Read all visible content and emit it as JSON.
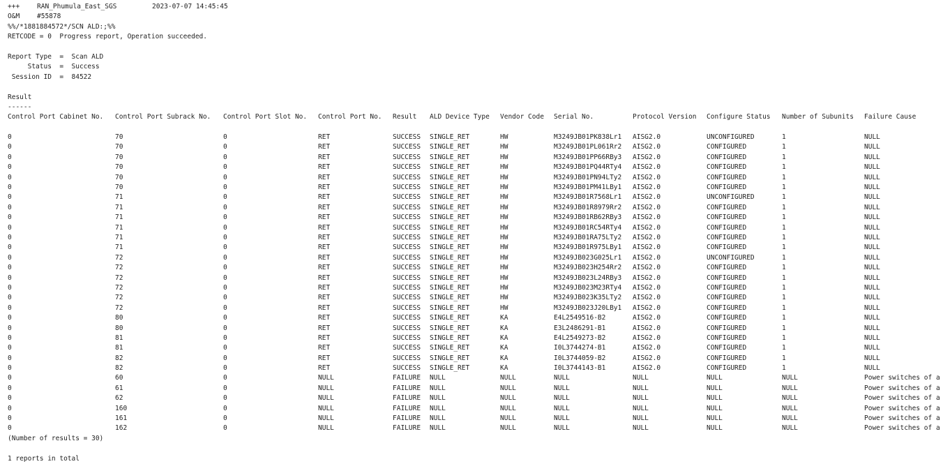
{
  "header": {
    "prefix": "+++",
    "ne_name": "RAN_Phumula_East_SGS",
    "timestamp": "2023-07-07 14:45:45",
    "om_label": "O&M",
    "om_number": "#55878",
    "command": "%%/*1881884572*/SCN ALD:;%%",
    "retcode": "RETCODE = 0  Progress report, Operation succeeded."
  },
  "report": {
    "type_line": "Report Type  =  Scan ALD",
    "status_line": "     Status  =  Success",
    "session_line": " Session ID  =  84522"
  },
  "result": {
    "title": "Result",
    "underline": "------",
    "columns": [
      "Control Port Cabinet No.",
      "Control Port Subrack No.",
      "Control Port Slot No.",
      "Control Port No.",
      "Result",
      "ALD Device Type",
      "Vendor Code",
      "Serial No.",
      "Protocol Version",
      "Configure Status",
      "Number of Subunits",
      "Failure Cause"
    ],
    "rows": [
      [
        "0",
        "70",
        "0",
        "RET",
        "SUCCESS",
        "SINGLE_RET",
        "HW",
        "M3249JB01PK838Lr1",
        "AISG2.0",
        "UNCONFIGURED",
        "1",
        "NULL"
      ],
      [
        "0",
        "70",
        "0",
        "RET",
        "SUCCESS",
        "SINGLE_RET",
        "HW",
        "M3249JB01PL061Rr2",
        "AISG2.0",
        "CONFIGURED",
        "1",
        "NULL"
      ],
      [
        "0",
        "70",
        "0",
        "RET",
        "SUCCESS",
        "SINGLE_RET",
        "HW",
        "M3249JB01PP66RBy3",
        "AISG2.0",
        "CONFIGURED",
        "1",
        "NULL"
      ],
      [
        "0",
        "70",
        "0",
        "RET",
        "SUCCESS",
        "SINGLE_RET",
        "HW",
        "M3249JB01PQ44RTy4",
        "AISG2.0",
        "CONFIGURED",
        "1",
        "NULL"
      ],
      [
        "0",
        "70",
        "0",
        "RET",
        "SUCCESS",
        "SINGLE_RET",
        "HW",
        "M3249JB01PN94LTy2",
        "AISG2.0",
        "CONFIGURED",
        "1",
        "NULL"
      ],
      [
        "0",
        "70",
        "0",
        "RET",
        "SUCCESS",
        "SINGLE_RET",
        "HW",
        "M3249JB01PM41LBy1",
        "AISG2.0",
        "CONFIGURED",
        "1",
        "NULL"
      ],
      [
        "0",
        "71",
        "0",
        "RET",
        "SUCCESS",
        "SINGLE_RET",
        "HW",
        "M3249JB01R7568Lr1",
        "AISG2.0",
        "UNCONFIGURED",
        "1",
        "NULL"
      ],
      [
        "0",
        "71",
        "0",
        "RET",
        "SUCCESS",
        "SINGLE_RET",
        "HW",
        "M3249JB01R8979Rr2",
        "AISG2.0",
        "CONFIGURED",
        "1",
        "NULL"
      ],
      [
        "0",
        "71",
        "0",
        "RET",
        "SUCCESS",
        "SINGLE_RET",
        "HW",
        "M3249JB01RB62RBy3",
        "AISG2.0",
        "CONFIGURED",
        "1",
        "NULL"
      ],
      [
        "0",
        "71",
        "0",
        "RET",
        "SUCCESS",
        "SINGLE_RET",
        "HW",
        "M3249JB01RC54RTy4",
        "AISG2.0",
        "CONFIGURED",
        "1",
        "NULL"
      ],
      [
        "0",
        "71",
        "0",
        "RET",
        "SUCCESS",
        "SINGLE_RET",
        "HW",
        "M3249JB01RA75LTy2",
        "AISG2.0",
        "CONFIGURED",
        "1",
        "NULL"
      ],
      [
        "0",
        "71",
        "0",
        "RET",
        "SUCCESS",
        "SINGLE_RET",
        "HW",
        "M3249JB01R975LBy1",
        "AISG2.0",
        "CONFIGURED",
        "1",
        "NULL"
      ],
      [
        "0",
        "72",
        "0",
        "RET",
        "SUCCESS",
        "SINGLE_RET",
        "HW",
        "M3249JB023G025Lr1",
        "AISG2.0",
        "UNCONFIGURED",
        "1",
        "NULL"
      ],
      [
        "0",
        "72",
        "0",
        "RET",
        "SUCCESS",
        "SINGLE_RET",
        "HW",
        "M3249JB023H254Rr2",
        "AISG2.0",
        "CONFIGURED",
        "1",
        "NULL"
      ],
      [
        "0",
        "72",
        "0",
        "RET",
        "SUCCESS",
        "SINGLE_RET",
        "HW",
        "M3249JB023L24RBy3",
        "AISG2.0",
        "CONFIGURED",
        "1",
        "NULL"
      ],
      [
        "0",
        "72",
        "0",
        "RET",
        "SUCCESS",
        "SINGLE_RET",
        "HW",
        "M3249JB023M23RTy4",
        "AISG2.0",
        "CONFIGURED",
        "1",
        "NULL"
      ],
      [
        "0",
        "72",
        "0",
        "RET",
        "SUCCESS",
        "SINGLE_RET",
        "HW",
        "M3249JB023K35LTy2",
        "AISG2.0",
        "CONFIGURED",
        "1",
        "NULL"
      ],
      [
        "0",
        "72",
        "0",
        "RET",
        "SUCCESS",
        "SINGLE_RET",
        "HW",
        "M3249JB023J20LBy1",
        "AISG2.0",
        "CONFIGURED",
        "1",
        "NULL"
      ],
      [
        "0",
        "80",
        "0",
        "RET",
        "SUCCESS",
        "SINGLE_RET",
        "KA",
        "E4L2549516-B2",
        "AISG2.0",
        "CONFIGURED",
        "1",
        "NULL"
      ],
      [
        "0",
        "80",
        "0",
        "RET",
        "SUCCESS",
        "SINGLE_RET",
        "KA",
        "E3L2486291-B1",
        "AISG2.0",
        "CONFIGURED",
        "1",
        "NULL"
      ],
      [
        "0",
        "81",
        "0",
        "RET",
        "SUCCESS",
        "SINGLE_RET",
        "KA",
        "E4L2549273-B2",
        "AISG2.0",
        "CONFIGURED",
        "1",
        "NULL"
      ],
      [
        "0",
        "81",
        "0",
        "RET",
        "SUCCESS",
        "SINGLE_RET",
        "KA",
        "I0L3744274-B1",
        "AISG2.0",
        "CONFIGURED",
        "1",
        "NULL"
      ],
      [
        "0",
        "82",
        "0",
        "RET",
        "SUCCESS",
        "SINGLE_RET",
        "KA",
        "I0L3744059-B2",
        "AISG2.0",
        "CONFIGURED",
        "1",
        "NULL"
      ],
      [
        "0",
        "82",
        "0",
        "RET",
        "SUCCESS",
        "SINGLE_RET",
        "KA",
        "I0L3744143-B1",
        "AISG2.0",
        "CONFIGURED",
        "1",
        "NULL"
      ],
      [
        "0",
        "60",
        "0",
        "NULL",
        "FAILURE",
        "NULL",
        "NULL",
        "NULL",
        "NULL",
        "NULL",
        "NULL",
        "Power switches of a"
      ],
      [
        "0",
        "61",
        "0",
        "NULL",
        "FAILURE",
        "NULL",
        "NULL",
        "NULL",
        "NULL",
        "NULL",
        "NULL",
        "Power switches of a"
      ],
      [
        "0",
        "62",
        "0",
        "NULL",
        "FAILURE",
        "NULL",
        "NULL",
        "NULL",
        "NULL",
        "NULL",
        "NULL",
        "Power switches of a"
      ],
      [
        "0",
        "160",
        "0",
        "NULL",
        "FAILURE",
        "NULL",
        "NULL",
        "NULL",
        "NULL",
        "NULL",
        "NULL",
        "Power switches of a"
      ],
      [
        "0",
        "161",
        "0",
        "NULL",
        "FAILURE",
        "NULL",
        "NULL",
        "NULL",
        "NULL",
        "NULL",
        "NULL",
        "Power switches of a"
      ],
      [
        "0",
        "162",
        "0",
        "NULL",
        "FAILURE",
        "NULL",
        "NULL",
        "NULL",
        "NULL",
        "NULL",
        "NULL",
        "Power switches of a"
      ]
    ],
    "count_line": "(Number of results = 30)"
  },
  "footer": {
    "total_line": "1 reports in total"
  },
  "colors": {
    "background": "#ffffff",
    "text": "#222222"
  }
}
